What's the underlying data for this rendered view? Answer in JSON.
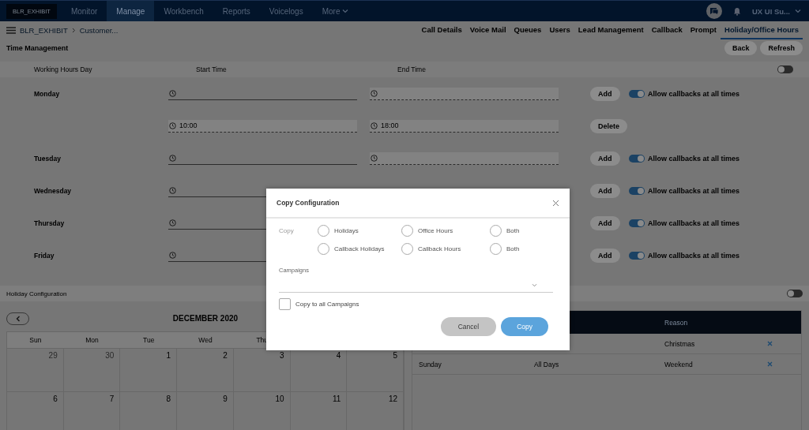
{
  "nav": {
    "logo": "BLR_EXHIBIT",
    "items": [
      {
        "label": "Monitor",
        "selected": false,
        "kind": "link"
      },
      {
        "label": "Manage",
        "selected": true,
        "kind": "link"
      },
      {
        "label": "Workbench",
        "selected": false,
        "kind": "link"
      },
      {
        "label": "Reports",
        "selected": false,
        "kind": "link"
      },
      {
        "label": "Voicelogs",
        "selected": false,
        "kind": "link"
      },
      {
        "label": "More",
        "selected": false,
        "kind": "menu"
      }
    ],
    "user": "UX UI Su..."
  },
  "breadcrumb": [
    "BLR_EXHIBIT",
    "Customer..."
  ],
  "tabs": [
    {
      "label": "Call Details",
      "selected": false
    },
    {
      "label": "Voice Mail",
      "selected": false
    },
    {
      "label": "Queues",
      "selected": false
    },
    {
      "label": "Users",
      "selected": false
    },
    {
      "label": "Lead Management",
      "selected": false
    },
    {
      "label": "Callback",
      "selected": false
    },
    {
      "label": "Prompt",
      "selected": false
    },
    {
      "label": "Holiday/Office Hours",
      "selected": true
    }
  ],
  "page_title": "Time Management",
  "actions": [
    "Back",
    "Refresh"
  ],
  "working_hours": {
    "columns": [
      "Working Hours Day",
      "Start Time",
      "End Time"
    ],
    "enabled": false,
    "rows": [
      {
        "day": "Monday",
        "start": {
          "disabled": false
        },
        "end": {
          "disabled": true
        },
        "action": "Add",
        "callbacks": {
          "label": "Allow callbacks at all times",
          "on": true
        }
      },
      {
        "start": {
          "value": "10:00",
          "disabled": true
        },
        "end": {
          "value": "18:00",
          "disabled": true
        },
        "action": "Delete"
      },
      {
        "day": "Tuesday",
        "start": {
          "disabled": false
        },
        "end": {
          "disabled": true
        },
        "action": "Add",
        "callbacks": {
          "label": "Allow callbacks at all times",
          "on": true
        }
      },
      {
        "day": "Wednesday",
        "start": {
          "disabled": false
        },
        "action": "Add",
        "callbacks": {
          "label": "Allow callbacks at all times",
          "on": true
        }
      },
      {
        "day": "Thursday",
        "start": {
          "disabled": false
        },
        "action": "Add",
        "callbacks": {
          "label": "Allow callbacks at all times",
          "on": true
        }
      },
      {
        "day": "Friday",
        "start": {
          "disabled": false
        },
        "action": "Add",
        "callbacks": {
          "label": "Allow callbacks at all times",
          "on": true
        }
      }
    ]
  },
  "holiday_configuration": {
    "title": "Holiday Configuration",
    "enabled": false
  },
  "calendar": {
    "month": "DECEMBER 2020",
    "weekdays": [
      "Sun",
      "Mon",
      "Tue",
      "Wed",
      "Thu"
    ],
    "weeks": [
      [
        {
          "day": "29",
          "muted": true
        },
        {
          "day": "30",
          "muted": true
        },
        {
          "day": "1",
          "muted": false
        },
        {
          "day": "2",
          "muted": false
        },
        {
          "day": "3",
          "muted": false
        },
        {
          "day": "4",
          "muted": false
        },
        {
          "day": "5",
          "muted": false
        }
      ],
      [
        {
          "day": "6",
          "muted": false
        },
        {
          "day": "7",
          "muted": false
        },
        {
          "day": "8",
          "muted": false
        },
        {
          "day": "9",
          "muted": false
        },
        {
          "day": "10",
          "muted": false
        },
        {
          "day": "11",
          "muted": false
        },
        {
          "day": "12",
          "muted": false
        }
      ]
    ]
  },
  "holiday_table": {
    "header": {
      "reason": "Reason"
    },
    "rows": [
      {
        "reason": "Christmas"
      },
      {
        "column_1": "Sunday",
        "column_2": "All Days",
        "reason": "Weekend"
      }
    ]
  },
  "dialog": {
    "title": "Copy Configuration",
    "copy_label": "Copy",
    "options": [
      {
        "label": "Holidays",
        "selected": false
      },
      {
        "label": "Office Hours",
        "selected": false
      },
      {
        "label": "Both",
        "selected": false
      },
      {
        "label": "Callback Holidays",
        "selected": false
      },
      {
        "label": "Callback Hours",
        "selected": false
      },
      {
        "label": "Both",
        "selected": false
      }
    ],
    "campaigns": {
      "label": "Campaigns"
    },
    "copy_all": {
      "label": "Copy to all Campaigns",
      "checked": false
    },
    "buttons": [
      {
        "label": "Cancel",
        "kind": "secondary",
        "disabled": true
      },
      {
        "label": "Copy",
        "kind": "primary",
        "disabled": false
      }
    ]
  }
}
